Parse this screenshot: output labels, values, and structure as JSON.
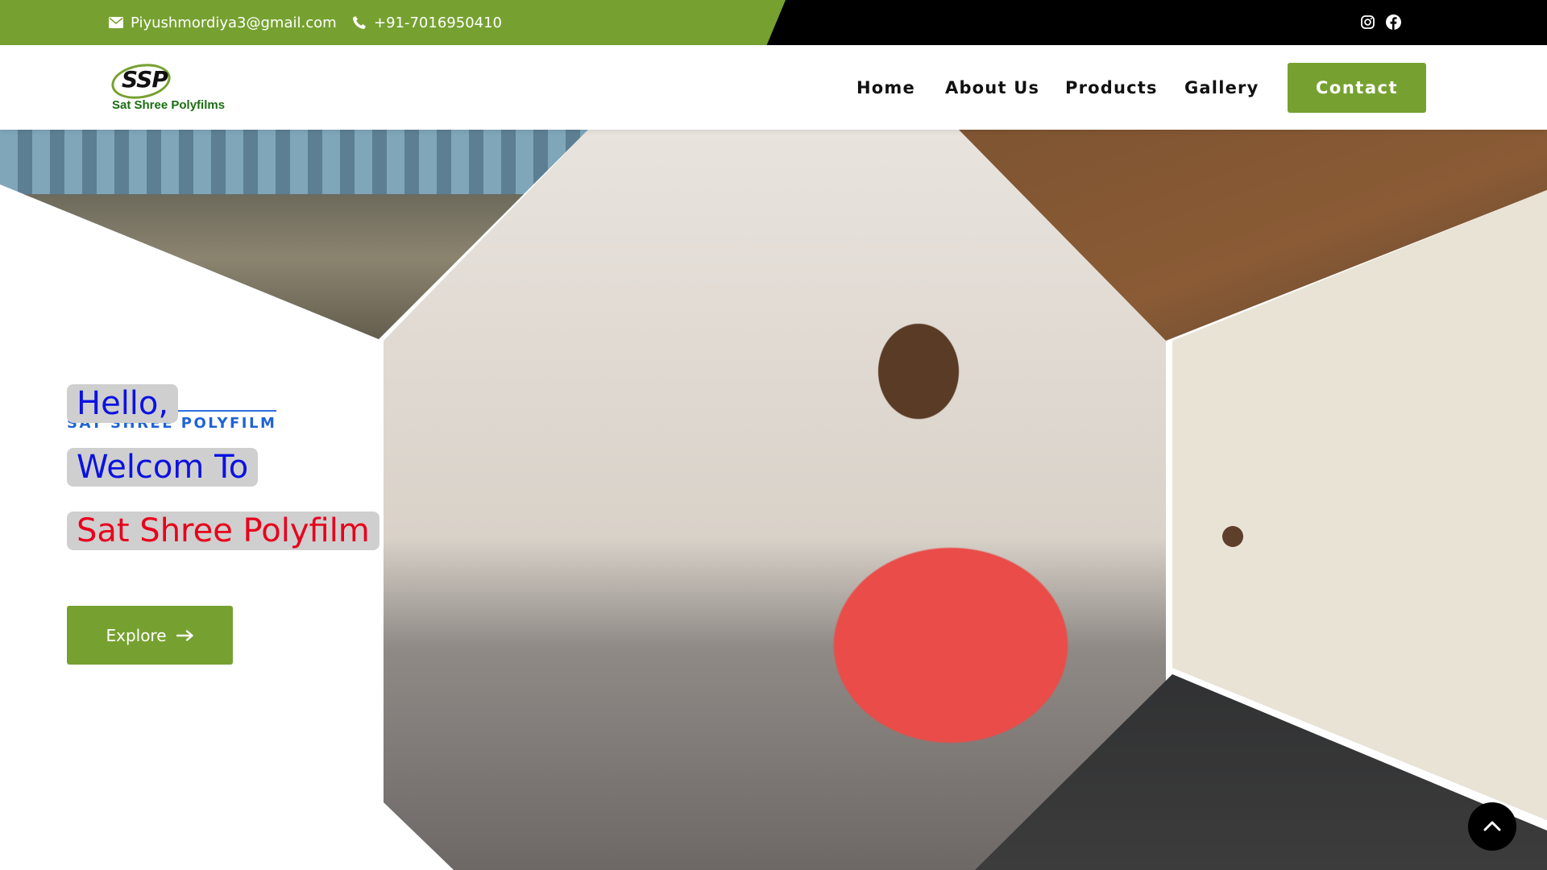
{
  "topbar": {
    "email": "Piyushmordiya3@gmail.com",
    "phone": "+91-7016950410",
    "social": [
      {
        "icon": "instagram-icon"
      },
      {
        "icon": "facebook-icon"
      }
    ],
    "colors": {
      "green": "#76a130",
      "dark": "#000000"
    }
  },
  "navbar": {
    "logo": {
      "mark": "SSP",
      "text": "Sat Shree Polyfilms"
    },
    "links": [
      "Home",
      "About Us",
      "Products",
      "Gallery"
    ],
    "contact_label": "Contact"
  },
  "hero": {
    "subtitle": "SAT SHREE POLYFILM",
    "line1": "Hello,",
    "line2": "Welcom To",
    "line3": "Sat Shree Polyfilm",
    "explore_label": "Explore",
    "colors": {
      "blue": "#0c12e0",
      "red": "#e8001c",
      "accent": "#1e63d6"
    }
  },
  "icons": {
    "scroll_top": "chevron-up-icon",
    "email": "envelope-icon",
    "phone": "phone-icon",
    "arrow": "arrow-right-icon"
  }
}
